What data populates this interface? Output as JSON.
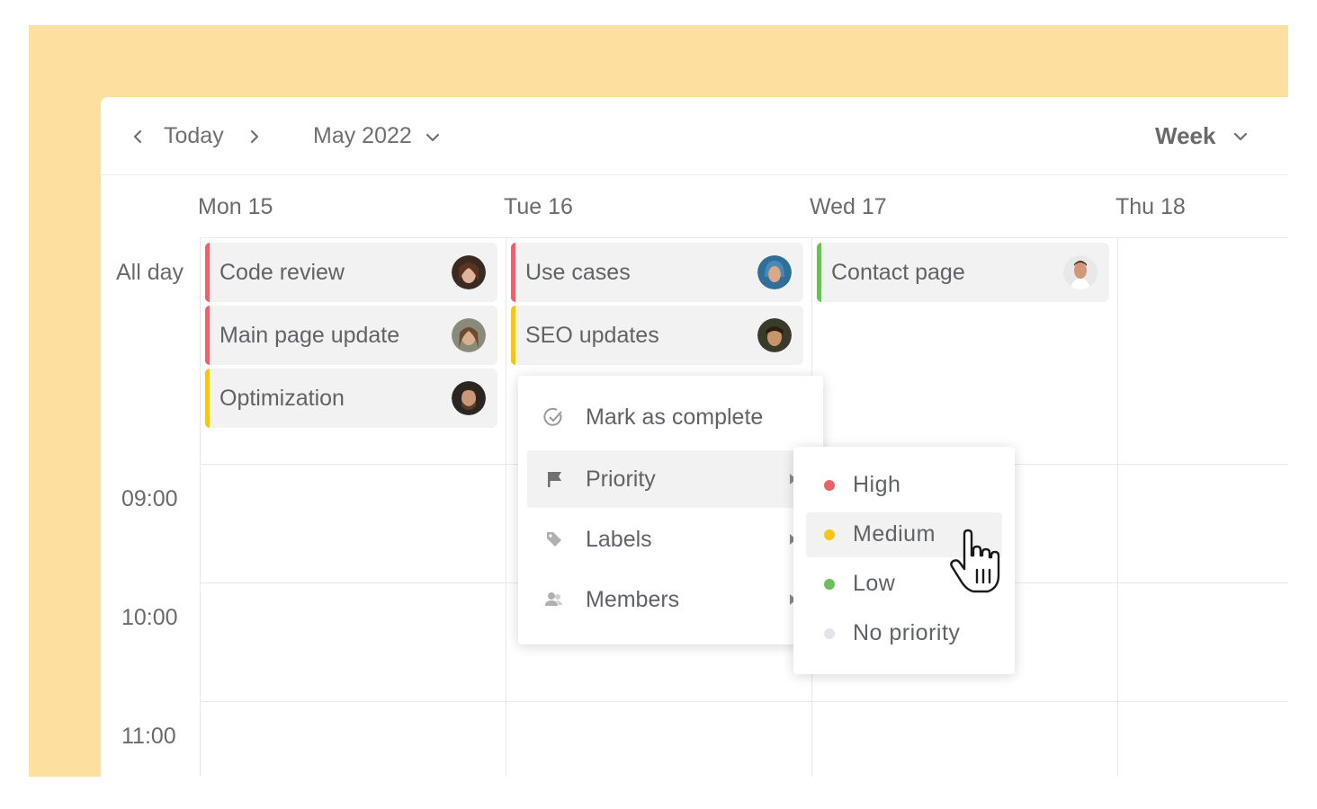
{
  "toolbar": {
    "prev_icon": "chevron-left-icon",
    "today_label": "Today",
    "next_icon": "chevron-right-icon",
    "month_label": "May 2022",
    "view_label": "Week"
  },
  "days": [
    "Mon 15",
    "Tue 16",
    "Wed 17",
    "Thu 18"
  ],
  "rows": {
    "all_day": "All day",
    "times": [
      "09:00",
      "10:00",
      "11:00"
    ]
  },
  "events": {
    "mon": [
      {
        "title": "Code review",
        "color": "#e8636a"
      },
      {
        "title": "Main page update",
        "color": "#e8636a"
      },
      {
        "title": "Optimization",
        "color": "#f5c518"
      }
    ],
    "tue": [
      {
        "title": "Use cases",
        "color": "#e8636a"
      },
      {
        "title": "SEO updates",
        "color": "#f5c518"
      }
    ],
    "wed": [
      {
        "title": "Contact page",
        "color": "#6cbf5b"
      }
    ]
  },
  "context_menu": {
    "items": [
      {
        "label": "Mark as complete",
        "icon": "check-circle-icon"
      },
      {
        "label": "Priority",
        "icon": "flag-icon"
      },
      {
        "label": "Labels",
        "icon": "tag-icon"
      },
      {
        "label": "Members",
        "icon": "people-icon"
      }
    ]
  },
  "priority_menu": {
    "items": [
      {
        "label": "High",
        "color": "#e8636a"
      },
      {
        "label": "Medium",
        "color": "#f5c518"
      },
      {
        "label": "Low",
        "color": "#6cbf5b"
      },
      {
        "label": "No priority",
        "color": "#e4e4ec"
      }
    ]
  },
  "colors": {
    "backdrop": "#fde09f",
    "panel": "#ffffff",
    "event_bg": "#f2f2f2"
  }
}
